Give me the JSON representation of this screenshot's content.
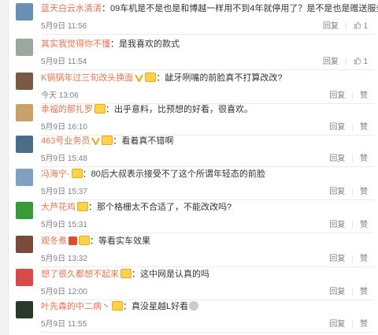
{
  "labels": {
    "reply": "回复",
    "like": "赞"
  },
  "comments": [
    {
      "user": "蓝天白云水清清",
      "badges": [],
      "text": "09车机是不是也是和博越一样用不到4年就停用了？是不是也是赠送服务？",
      "time": "5月9日 11:56",
      "like_count": "1",
      "avatar_color": "#6a8fb5"
    },
    {
      "user": "其实我觉得你不懂",
      "badges": [],
      "text": "是我喜欢的款式",
      "time": "5月9日 11:54",
      "like_count": "1",
      "avatar_color": "#9aa8a0"
    },
    {
      "user": "K锅锅年过三旬改头换面",
      "badges": [
        "v",
        "vip"
      ],
      "text": "龇牙咧嘴的前脸真不打算改改?",
      "time": "今天 13:06",
      "like_count": "",
      "avatar_color": "#7a5a46"
    },
    {
      "user": "幸福的那扎罗",
      "badges": [
        "vip"
      ],
      "text": "出乎意料，比预想的好看，很喜欢。",
      "time": "5月9日 16:10",
      "like_count": "",
      "avatar_color": "#c9a06a"
    },
    {
      "user": "463号业务员",
      "badges": [
        "v",
        "vip"
      ],
      "text": "看着真不错啊",
      "time": "5月9日 15:48",
      "like_count": "",
      "avatar_color": "#4a6e8a"
    },
    {
      "user": "冯海宁-",
      "badges": [
        "vip"
      ],
      "text": "80后大叔表示接受不了这个所谓年轻态的前脸",
      "time": "5月9日 15:37",
      "like_count": "",
      "avatar_color": "#7fa0c0"
    },
    {
      "user": "大芦花鸡",
      "badges": [
        "vip"
      ],
      "text": "那个格栅太不合适了，不能改改吗?",
      "time": "5月9日 15:31",
      "like_count": "",
      "avatar_color": "#3a9a3a"
    },
    {
      "user": "观冬煮",
      "badges": [
        "red",
        "vip"
      ],
      "text": "等看实车效果",
      "time": "5月9日 13:32",
      "like_count": "",
      "avatar_color": "#7a4a3a"
    },
    {
      "user": "想了很久都想不起来",
      "badges": [
        "vip"
      ],
      "text": "这中网是认真的吗",
      "time": "5月9日 12:00",
      "like_count": "",
      "avatar_color": "#d64a4a"
    },
    {
      "user": "叶先森的中二病丶",
      "badges": [
        "vip"
      ],
      "text": "真没星越L好看",
      "time": "5月9日 11:55",
      "like_count": "",
      "avatar_color": "#2a3a2a"
    }
  ]
}
